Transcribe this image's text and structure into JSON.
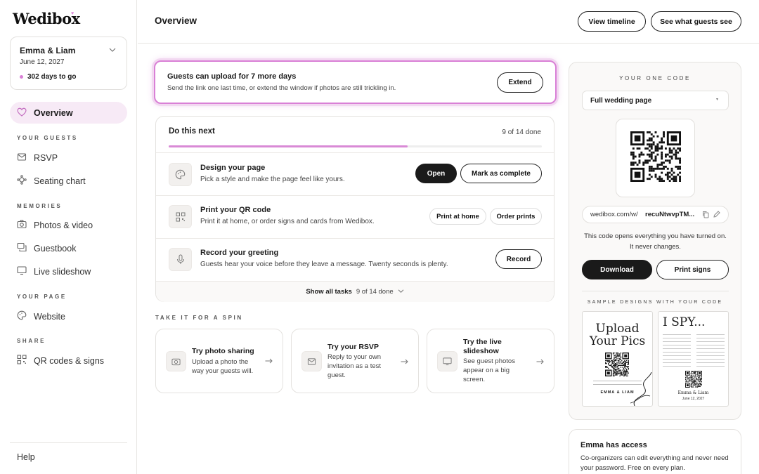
{
  "brand": "Wedibox",
  "event": {
    "names": "Emma & Liam",
    "date": "June 12, 2027",
    "countdown": "302 days to go"
  },
  "sidebar": {
    "overview": "Overview",
    "sections": [
      {
        "title": "YOUR GUESTS",
        "items": [
          "RSVP",
          "Seating chart"
        ]
      },
      {
        "title": "MEMORIES",
        "items": [
          "Photos & video",
          "Guestbook",
          "Live slideshow"
        ]
      },
      {
        "title": "YOUR PAGE",
        "items": [
          "Website"
        ]
      },
      {
        "title": "SHARE",
        "items": [
          "QR codes & signs"
        ]
      }
    ],
    "help": "Help"
  },
  "header": {
    "title": "Overview",
    "view_timeline": "View timeline",
    "see_guests": "See what guests see"
  },
  "upload_banner": {
    "title": "Guests can upload for 7 more days",
    "desc": "Send the link one last time, or extend the window if photos are still trickling in.",
    "button": "Extend"
  },
  "tasks": {
    "title": "Do this next",
    "progress_text": "9 of 14 done",
    "progress": 0.64,
    "items": [
      {
        "title": "Design your page",
        "desc": "Pick a style and make the page feel like yours.",
        "btn1": "Open",
        "btn2": "Mark as complete"
      },
      {
        "title": "Print your QR code",
        "desc": "Print it at home, or order signs and cards from Wedibox.",
        "btn1": "Print at home",
        "btn2": "Order prints"
      },
      {
        "title": "Record your greeting",
        "desc": "Guests hear your voice before they leave a message. Twenty seconds is plenty.",
        "btn1": "Record"
      }
    ],
    "show_all": "Show all tasks",
    "show_all_count": "9 of 14 done"
  },
  "spin": {
    "title": "TAKE IT FOR A SPIN",
    "cards": [
      {
        "title": "Try photo sharing",
        "desc": "Upload a photo the way your guests will."
      },
      {
        "title": "Try your RSVP",
        "desc": "Reply to your own invitation as a test guest."
      },
      {
        "title": "Try the live slideshow",
        "desc": "See guest photos appear on a big screen."
      }
    ]
  },
  "code_panel": {
    "title": "YOUR ONE CODE",
    "select": "Full wedding page",
    "url_prefix": "wedibox.com/w/",
    "url_code": "recuNtwvpTM...",
    "note": "This code opens everything you have turned on. It never changes.",
    "download": "Download",
    "print_signs": "Print signs",
    "samples_title": "SAMPLE DESIGNS WITH YOUR CODE",
    "sample1": {
      "line1": "Upload",
      "line2": "Your Pics",
      "names": "EMMA & LIAM"
    },
    "sample2": {
      "title": "I SPY...",
      "names": "Emma & Liam",
      "date": "June 12, 2027"
    }
  },
  "access": {
    "title": "Emma has access",
    "desc": "Co-organizers can edit everything and never need your password. Free on every plan."
  },
  "colors": {
    "accent": "#d980d6",
    "progress": "#d98ad6",
    "overview_bg": "#f7eaf6",
    "dark": "#1a1a1a"
  }
}
